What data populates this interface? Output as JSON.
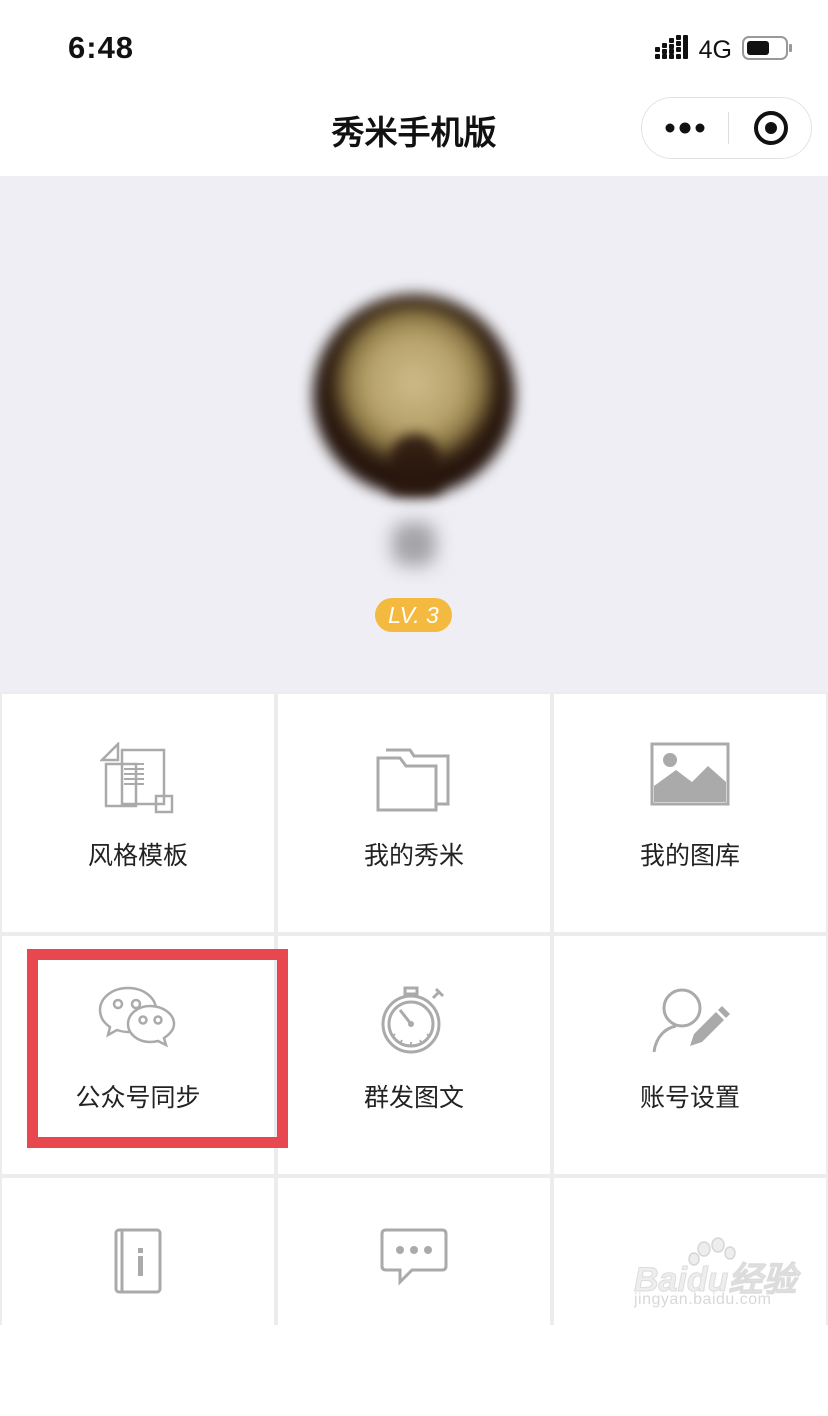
{
  "status_bar": {
    "time": "6:48",
    "network": "4G"
  },
  "nav": {
    "title": "秀米手机版"
  },
  "profile": {
    "level": "LV. 3"
  },
  "menu": {
    "items": [
      {
        "label": "风格模板",
        "icon": "template-icon"
      },
      {
        "label": "我的秀米",
        "icon": "folder-icon"
      },
      {
        "label": "我的图库",
        "icon": "image-gallery-icon"
      },
      {
        "label": "公众号同步",
        "icon": "wechat-icon"
      },
      {
        "label": "群发图文",
        "icon": "stopwatch-icon"
      },
      {
        "label": "账号设置",
        "icon": "user-edit-icon"
      },
      {
        "label": "",
        "icon": "info-book-icon"
      },
      {
        "label": "",
        "icon": "chat-bubble-icon"
      },
      {
        "label": "",
        "icon": ""
      }
    ]
  },
  "annotation": {
    "color": "#e8474f",
    "target": "公众号同步"
  },
  "watermark": {
    "brand": "Baidu经验",
    "url": "jingyan.baidu.com"
  },
  "colors": {
    "level_badge": "#f4ba3f",
    "profile_bg": "#eeeef4",
    "icon_gray": "#a8a8a8"
  }
}
